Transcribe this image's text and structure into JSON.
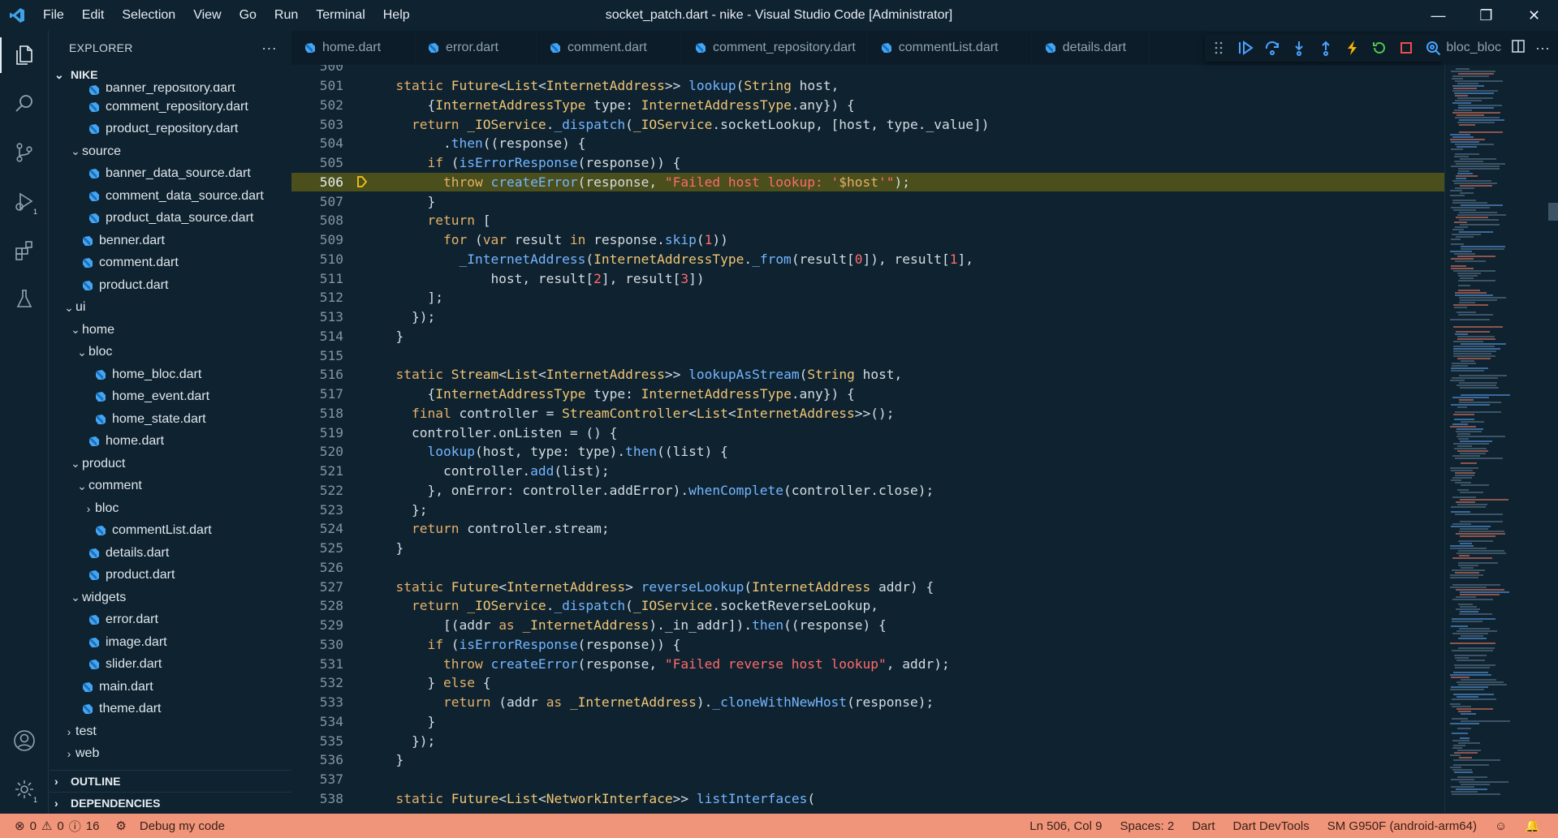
{
  "window": {
    "title": "socket_patch.dart - nike - Visual Studio Code [Administrator]",
    "menu": [
      "File",
      "Edit",
      "Selection",
      "View",
      "Go",
      "Run",
      "Terminal",
      "Help"
    ]
  },
  "activity_bar": {
    "items": [
      "files-icon",
      "search-icon",
      "source-control-icon",
      "run-debug-icon",
      "extensions-icon",
      "testing-icon"
    ],
    "run_debug_badge": "1",
    "settings_badge": "1"
  },
  "sidebar": {
    "header": "EXPLORER",
    "more": "···",
    "root": "NIKE",
    "tree": [
      {
        "label": "banner_repository.dart",
        "depth": 3,
        "kind": "file"
      },
      {
        "label": "comment_repository.dart",
        "depth": 3,
        "kind": "file"
      },
      {
        "label": "product_repository.dart",
        "depth": 3,
        "kind": "file"
      },
      {
        "label": "source",
        "depth": 2,
        "kind": "folder-open"
      },
      {
        "label": "banner_data_source.dart",
        "depth": 3,
        "kind": "file"
      },
      {
        "label": "comment_data_source.dart",
        "depth": 3,
        "kind": "file"
      },
      {
        "label": "product_data_source.dart",
        "depth": 3,
        "kind": "file"
      },
      {
        "label": "benner.dart",
        "depth": 2,
        "kind": "file"
      },
      {
        "label": "comment.dart",
        "depth": 2,
        "kind": "file"
      },
      {
        "label": "product.dart",
        "depth": 2,
        "kind": "file"
      },
      {
        "label": "ui",
        "depth": 1,
        "kind": "folder-open"
      },
      {
        "label": "home",
        "depth": 2,
        "kind": "folder-open"
      },
      {
        "label": "bloc",
        "depth": 3,
        "kind": "folder-open"
      },
      {
        "label": "home_bloc.dart",
        "depth": 4,
        "kind": "file"
      },
      {
        "label": "home_event.dart",
        "depth": 4,
        "kind": "file"
      },
      {
        "label": "home_state.dart",
        "depth": 4,
        "kind": "file"
      },
      {
        "label": "home.dart",
        "depth": 3,
        "kind": "file"
      },
      {
        "label": "product",
        "depth": 2,
        "kind": "folder-open"
      },
      {
        "label": "comment",
        "depth": 3,
        "kind": "folder-open"
      },
      {
        "label": "bloc",
        "depth": 4,
        "kind": "folder-closed"
      },
      {
        "label": "commentList.dart",
        "depth": 4,
        "kind": "file"
      },
      {
        "label": "details.dart",
        "depth": 3,
        "kind": "file"
      },
      {
        "label": "product.dart",
        "depth": 3,
        "kind": "file"
      },
      {
        "label": "widgets",
        "depth": 2,
        "kind": "folder-open"
      },
      {
        "label": "error.dart",
        "depth": 3,
        "kind": "file"
      },
      {
        "label": "image.dart",
        "depth": 3,
        "kind": "file"
      },
      {
        "label": "slider.dart",
        "depth": 3,
        "kind": "file"
      },
      {
        "label": "main.dart",
        "depth": 2,
        "kind": "file"
      },
      {
        "label": "theme.dart",
        "depth": 2,
        "kind": "file"
      },
      {
        "label": "test",
        "depth": 1,
        "kind": "folder-closed"
      },
      {
        "label": "web",
        "depth": 1,
        "kind": "folder-closed"
      }
    ],
    "outline": "OUTLINE",
    "dependencies": "DEPENDENCIES"
  },
  "editor": {
    "tabs": [
      "home.dart",
      "error.dart",
      "comment.dart",
      "comment_repository.dart",
      "commentList.dart",
      "details.dart"
    ],
    "tab_overflow": "bloc_bloc",
    "current_line": 506,
    "lines": [
      {
        "n": "500",
        "html": ""
      },
      {
        "n": "501",
        "html": "  <span class='k'>static</span> <span class='t'>Future</span>&lt;<span class='t'>List</span>&lt;<span class='t'>InternetAddress</span>&gt;&gt; <span class='f'>lookup</span>(<span class='t'>String</span> host,"
      },
      {
        "n": "502",
        "html": "      {<span class='t'>InternetAddressType</span> type: <span class='t'>InternetAddressType</span>.any}) {"
      },
      {
        "n": "503",
        "html": "    <span class='k'>return</span> <span class='t'>_IOService</span>.<span class='f'>_dispatch</span>(<span class='t'>_IOService</span>.socketLookup, [host, type._value])"
      },
      {
        "n": "504",
        "html": "        .<span class='f'>then</span>((response) {"
      },
      {
        "n": "505",
        "html": "      <span class='k'>if</span> (<span class='f'>isErrorResponse</span>(response)) {"
      },
      {
        "n": "506",
        "html": "        <span class='k'>throw</span> <span class='f'>createError</span>(response, <span class='s'>\"Failed host lookup: '</span><span class='k'>$host</span><span class='s'>'\"</span>);"
      },
      {
        "n": "507",
        "html": "      }"
      },
      {
        "n": "508",
        "html": "      <span class='k'>return</span> ["
      },
      {
        "n": "509",
        "html": "        <span class='k'>for</span> (<span class='k'>var</span> result <span class='k'>in</span> response.<span class='f'>skip</span>(<span class='n'>1</span>))"
      },
      {
        "n": "510",
        "html": "          <span class='f'>_InternetAddress</span>(<span class='t'>InternetAddressType</span>.<span class='f'>_from</span>(result[<span class='n'>0</span>]), result[<span class='n'>1</span>],"
      },
      {
        "n": "511",
        "html": "              host, result[<span class='n'>2</span>], result[<span class='n'>3</span>])"
      },
      {
        "n": "512",
        "html": "      ];"
      },
      {
        "n": "513",
        "html": "    });"
      },
      {
        "n": "514",
        "html": "  }"
      },
      {
        "n": "515",
        "html": ""
      },
      {
        "n": "516",
        "html": "  <span class='k'>static</span> <span class='t'>Stream</span>&lt;<span class='t'>List</span>&lt;<span class='t'>InternetAddress</span>&gt;&gt; <span class='f'>lookupAsStream</span>(<span class='t'>String</span> host,"
      },
      {
        "n": "517",
        "html": "      {<span class='t'>InternetAddressType</span> type: <span class='t'>InternetAddressType</span>.any}) {"
      },
      {
        "n": "518",
        "html": "    <span class='k'>final</span> controller = <span class='t'>StreamController</span>&lt;<span class='t'>List</span>&lt;<span class='t'>InternetAddress</span>&gt;&gt;();"
      },
      {
        "n": "519",
        "html": "    controller.onListen = () {"
      },
      {
        "n": "520",
        "html": "      <span class='f'>lookup</span>(host, type: type).<span class='f'>then</span>((list) {"
      },
      {
        "n": "521",
        "html": "        controller.<span class='f'>add</span>(list);"
      },
      {
        "n": "522",
        "html": "      }, onError: controller.addError).<span class='f'>whenComplete</span>(controller.close);"
      },
      {
        "n": "523",
        "html": "    };"
      },
      {
        "n": "524",
        "html": "    <span class='k'>return</span> controller.stream;"
      },
      {
        "n": "525",
        "html": "  }"
      },
      {
        "n": "526",
        "html": ""
      },
      {
        "n": "527",
        "html": "  <span class='k'>static</span> <span class='t'>Future</span>&lt;<span class='t'>InternetAddress</span>&gt; <span class='f'>reverseLookup</span>(<span class='t'>InternetAddress</span> addr) {"
      },
      {
        "n": "528",
        "html": "    <span class='k'>return</span> <span class='t'>_IOService</span>.<span class='f'>_dispatch</span>(<span class='t'>_IOService</span>.socketReverseLookup,"
      },
      {
        "n": "529",
        "html": "        [(addr <span class='k'>as</span> <span class='t'>_InternetAddress</span>)._in_addr]).<span class='f'>then</span>((response) {"
      },
      {
        "n": "530",
        "html": "      <span class='k'>if</span> (<span class='f'>isErrorResponse</span>(response)) {"
      },
      {
        "n": "531",
        "html": "        <span class='k'>throw</span> <span class='f'>createError</span>(response, <span class='s'>\"Failed reverse host lookup\"</span>, addr);"
      },
      {
        "n": "532",
        "html": "      } <span class='k'>else</span> {"
      },
      {
        "n": "533",
        "html": "        <span class='k'>return</span> (addr <span class='k'>as</span> <span class='t'>_InternetAddress</span>).<span class='f'>_cloneWithNewHost</span>(response);"
      },
      {
        "n": "534",
        "html": "      }"
      },
      {
        "n": "535",
        "html": "    });"
      },
      {
        "n": "536",
        "html": "  }"
      },
      {
        "n": "537",
        "html": ""
      },
      {
        "n": "538",
        "html": "  <span class='k'>static</span> <span class='t'>Future</span>&lt;<span class='t'>List</span>&lt;<span class='t'>NetworkInterface</span>&gt;&gt; <span class='f'>listInterfaces</span>("
      }
    ]
  },
  "status_bar": {
    "errors": "0",
    "warnings": "0",
    "info": "16",
    "debug_label": "Debug my code",
    "cursor": "Ln 506, Col 9",
    "spaces": "Spaces: 2",
    "language": "Dart",
    "devtools": "Dart DevTools",
    "device": "SM G950F (android-arm64)"
  },
  "colors": {
    "background": "#0f2230",
    "statusbar": "#f0957a",
    "current_line": "#4a4f1c",
    "keyword": "#e5b16a",
    "function": "#74b6ff",
    "string": "#ff6b6b"
  }
}
